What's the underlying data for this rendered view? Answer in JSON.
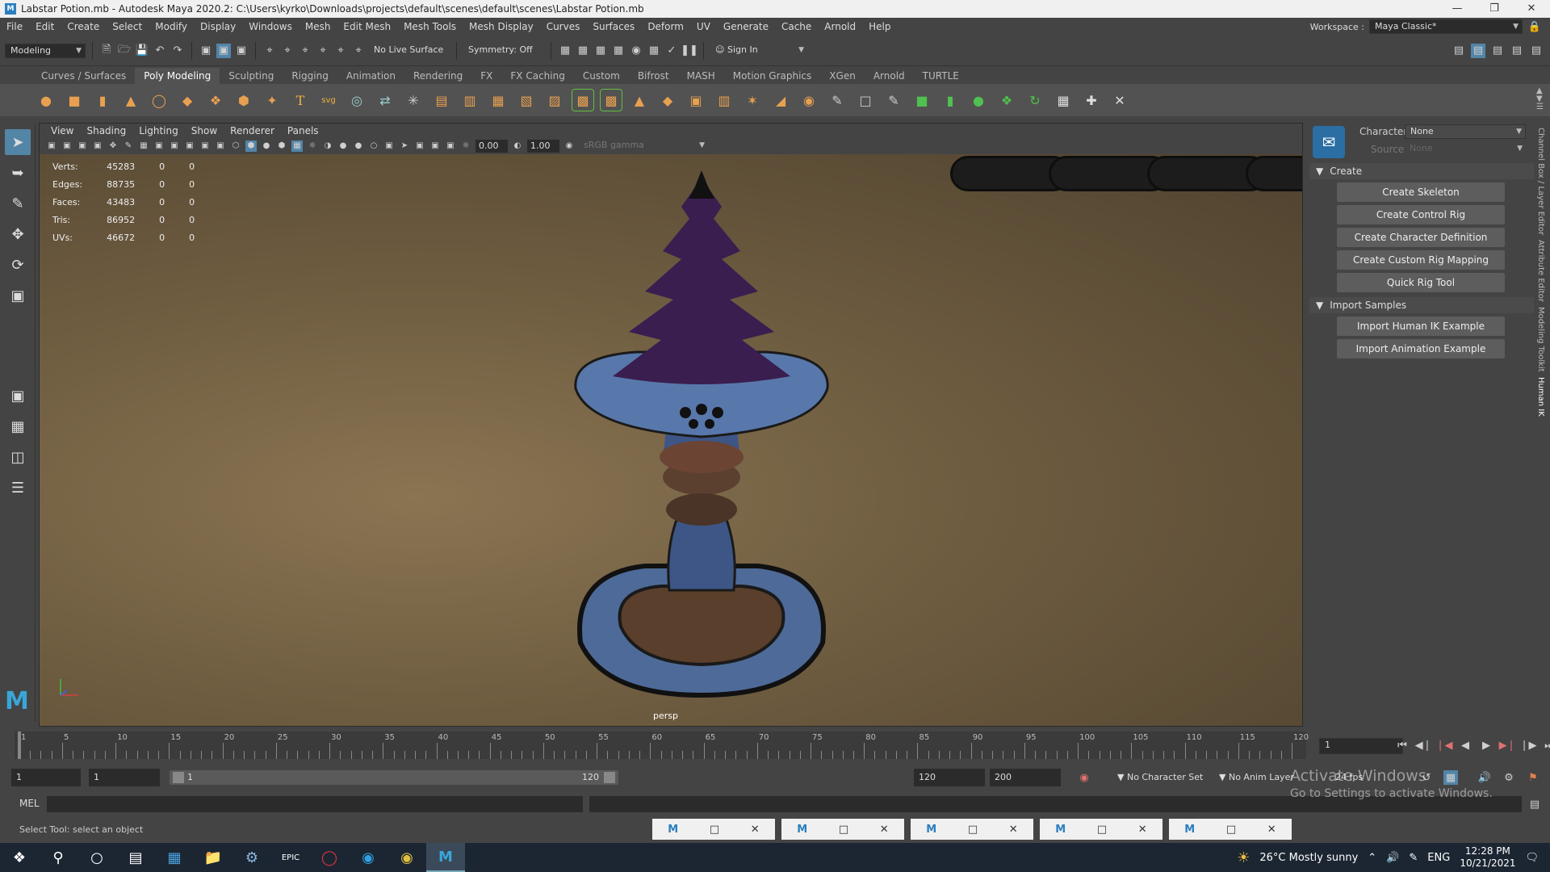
{
  "window": {
    "title": "Labstar Potion.mb - Autodesk Maya 2020.2: C:\\Users\\kyrko\\Downloads\\projects\\default\\scenes\\default\\scenes\\Labstar Potion.mb"
  },
  "menu": [
    "File",
    "Edit",
    "Create",
    "Select",
    "Modify",
    "Display",
    "Windows",
    "Mesh",
    "Edit Mesh",
    "Mesh Tools",
    "Mesh Display",
    "Curves",
    "Surfaces",
    "Deform",
    "UV",
    "Generate",
    "Cache",
    "Arnold",
    "Help"
  ],
  "workspace": {
    "label": "Workspace :",
    "value": "Maya Classic*"
  },
  "statusline": {
    "mode": "Modeling",
    "live_surface": "No Live Surface",
    "symmetry": "Symmetry: Off",
    "sign_in": "Sign In"
  },
  "shelf_tabs": [
    "Curves / Surfaces",
    "Poly Modeling",
    "Sculpting",
    "Rigging",
    "Animation",
    "Rendering",
    "FX",
    "FX Caching",
    "Custom",
    "Bifrost",
    "MASH",
    "Motion Graphics",
    "XGen",
    "Arnold",
    "TURTLE"
  ],
  "viewport": {
    "menu": [
      "View",
      "Shading",
      "Lighting",
      "Show",
      "Renderer",
      "Panels"
    ],
    "field_a": "0.00",
    "field_b": "1.00",
    "color_space": "sRGB gamma",
    "camera": "persp",
    "hud": [
      {
        "label": "Verts:",
        "v1": "45283",
        "v2": "0",
        "v3": "0"
      },
      {
        "label": "Edges:",
        "v1": "88735",
        "v2": "0",
        "v3": "0"
      },
      {
        "label": "Faces:",
        "v1": "43483",
        "v2": "0",
        "v3": "0"
      },
      {
        "label": "Tris:",
        "v1": "86952",
        "v2": "0",
        "v3": "0"
      },
      {
        "label": "UVs:",
        "v1": "46672",
        "v2": "0",
        "v3": "0"
      }
    ]
  },
  "humanik": {
    "character_label": "Character:",
    "character_value": "None",
    "source_label": "Source:",
    "source_value": "None",
    "create_section": "Create",
    "create_buttons": [
      "Create Skeleton",
      "Create Control Rig",
      "Create Character Definition",
      "Create Custom Rig Mapping",
      "Quick Rig Tool"
    ],
    "import_section": "Import Samples",
    "import_buttons": [
      "Import Human IK Example",
      "Import Animation Example"
    ]
  },
  "side_tabs": [
    "Channel Box / Layer Editor",
    "Attribute Editor",
    "Modeling Toolkit",
    "Human IK"
  ],
  "timeline": {
    "ticks": [
      "1",
      "5",
      "10",
      "15",
      "20",
      "25",
      "30",
      "35",
      "40",
      "45",
      "50",
      "55",
      "60",
      "65",
      "70",
      "75",
      "80",
      "85",
      "90",
      "95",
      "100",
      "105",
      "110",
      "115",
      "120"
    ],
    "current_frame": "1"
  },
  "range": {
    "start": "1",
    "anim_start": "1",
    "slider_start": "1",
    "slider_end": "120",
    "anim_end": "120",
    "end": "200",
    "character_set": "No Character Set",
    "anim_layer": "No Anim Layer",
    "fps": "24 fps"
  },
  "command": {
    "label": "MEL"
  },
  "help_line": "Select Tool: select an object",
  "watermark": {
    "line1": "Activate Windows",
    "line2": "Go to Settings to activate Windows."
  },
  "tray": {
    "weather": "26°C  Mostly sunny",
    "lang": "ENG",
    "time": "12:28 PM",
    "date": "10/21/2021"
  }
}
